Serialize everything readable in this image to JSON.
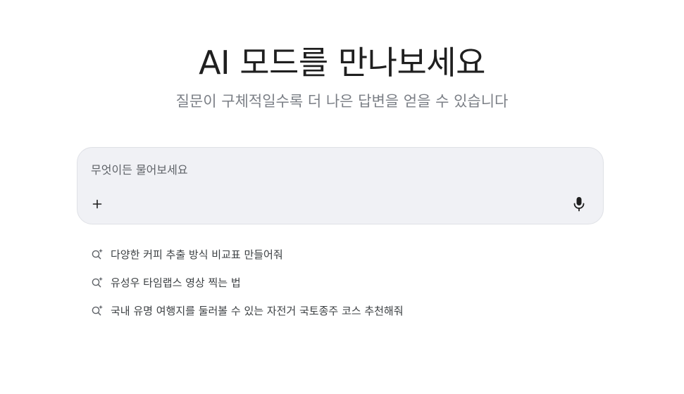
{
  "header": {
    "title": "AI 모드를 만나보세요",
    "subtitle": "질문이 구체적일수록 더 나은 답변을 얻을 수 있습니다"
  },
  "search": {
    "placeholder": "무엇이든 물어보세요",
    "value": "",
    "plus_icon": "plus-icon",
    "mic_icon": "microphone-icon"
  },
  "suggestions": [
    {
      "icon": "search-sparkle-icon",
      "label": "다양한 커피 추출 방식 비교표 만들어줘"
    },
    {
      "icon": "search-sparkle-icon",
      "label": "유성우 타임랩스 영상 찍는 법"
    },
    {
      "icon": "search-sparkle-icon",
      "label": "국내 유명 여행지를 둘러볼 수 있는 자전거 국토종주 코스 추천해줘"
    }
  ],
  "colors": {
    "title": "#1f1f1f",
    "subtitle": "#7b7f86",
    "search_bg": "#f0f1f5",
    "search_border": "#dfe1e6",
    "suggestion_text": "#3c4043"
  }
}
